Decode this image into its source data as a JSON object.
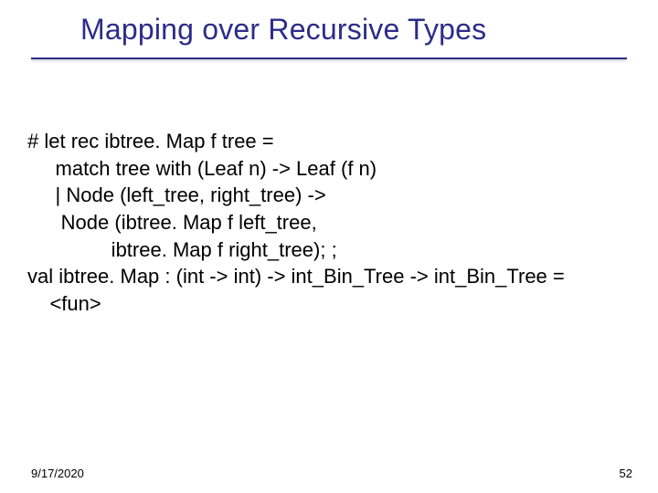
{
  "title": "Mapping over Recursive Types",
  "code": {
    "l1": "# let rec ibtree. Map f tree =",
    "l2": "     match tree with (Leaf n) -> Leaf (f n)",
    "l3": "     | Node (left_tree, right_tree) ->",
    "l4": "      Node (ibtree. Map f left_tree,",
    "l5": "               ibtree. Map f right_tree); ;",
    "l6": "val ibtree. Map : (int -> int) -> int_Bin_Tree -> int_Bin_Tree =",
    "l7": "    <fun>"
  },
  "footer": {
    "date": "9/17/2020",
    "page": "52"
  }
}
